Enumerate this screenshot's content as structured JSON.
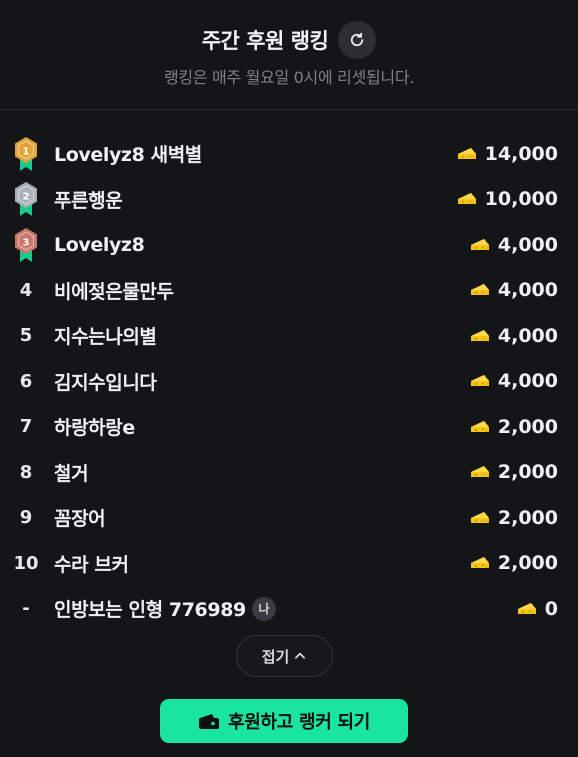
{
  "header": {
    "title": "주간 후원 랭킹",
    "subtitle": "랭킹은 매주 월요일 0시에 리셋됩니다."
  },
  "rows": [
    {
      "rank": "1",
      "medal": "gold-medal-icon",
      "name": "Lovelyz8 새벽별",
      "amount": "14,000"
    },
    {
      "rank": "2",
      "medal": "silver-medal-icon",
      "name": "푸른행운",
      "amount": "10,000"
    },
    {
      "rank": "3",
      "medal": "bronze-medal-icon",
      "name": "Lovelyz8",
      "amount": "4,000"
    },
    {
      "rank": "4",
      "name": "비에젖은물만두",
      "amount": "4,000"
    },
    {
      "rank": "5",
      "name": "지수는나의별",
      "amount": "4,000"
    },
    {
      "rank": "6",
      "name": "김지수입니다",
      "amount": "4,000"
    },
    {
      "rank": "7",
      "name": "하랑하랑e",
      "amount": "2,000"
    },
    {
      "rank": "8",
      "name": "철거",
      "amount": "2,000"
    },
    {
      "rank": "9",
      "name": "꼼장어",
      "amount": "2,000"
    },
    {
      "rank": "10",
      "name": "수라 브커",
      "amount": "2,000"
    },
    {
      "rank": "-",
      "name": "인방보는 인형 776989",
      "me_badge": "나",
      "amount": "0"
    }
  ],
  "fold_button": {
    "label": "접기",
    "icon": "chevron-up-icon"
  },
  "cta_button": {
    "label": "후원하고 랭커 되기",
    "icon": "cheese-wallet-icon"
  },
  "colors": {
    "background": "#141517",
    "accent": "#19e5a0",
    "cheese": "#f5c518",
    "gold": "#e0a43a",
    "silver": "#a9b0bb",
    "bronze": "#c9776a",
    "ribbon": "#19c98e"
  }
}
